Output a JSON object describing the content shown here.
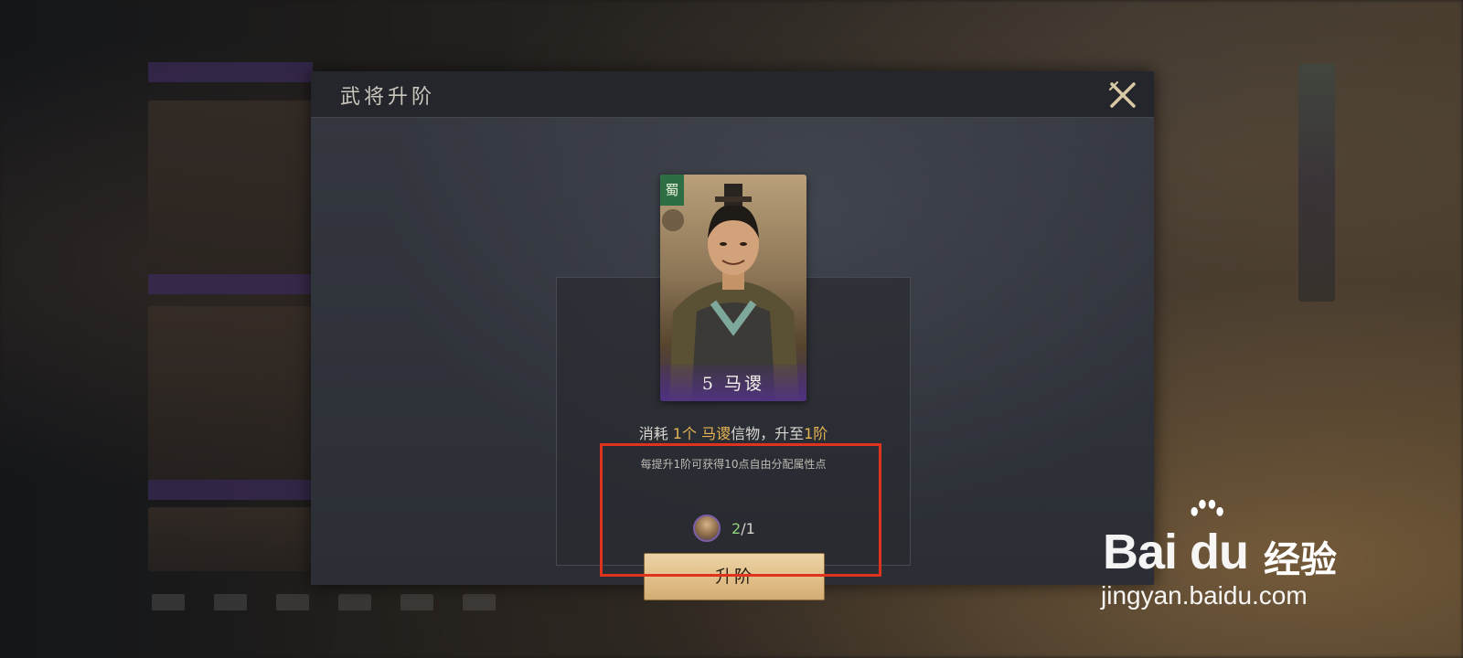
{
  "modal": {
    "title": "武将升阶"
  },
  "hero": {
    "faction": "蜀",
    "card_label": "5 马谡"
  },
  "consume": {
    "prefix": "消耗 ",
    "count": "1个",
    "sp1": " ",
    "item_name": "马谡",
    "mid": "信物，升至",
    "rank": "1阶"
  },
  "hint": "每提升1阶可获得10点自由分配属性点",
  "token": {
    "have": "2",
    "need": "/1"
  },
  "upgrade_button": "升阶",
  "watermark": {
    "logo_text": "Bai du",
    "logo_cn": "经验",
    "url": "jingyan.baidu.com"
  },
  "colors": {
    "accent_gold": "#e5b454",
    "highlight_red": "#e0331f",
    "faction_green": "#2e6e45",
    "card_purple": "#503282"
  }
}
